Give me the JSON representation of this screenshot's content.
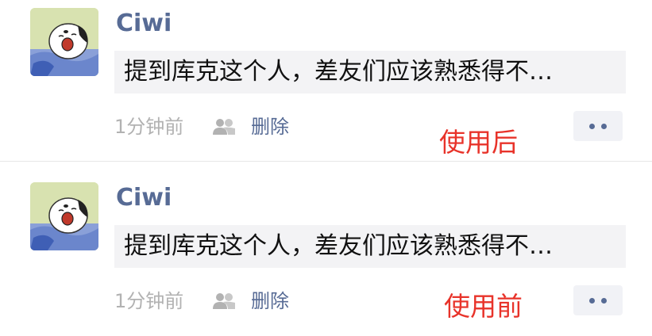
{
  "posts": [
    {
      "author": "Ciwi",
      "share_text": "提到库克这个人，差友们应该熟悉得不…",
      "time": "1分钟前",
      "friends_icon": "two-people-icon",
      "delete_label": "删除",
      "more_icon": "two-dots-icon",
      "annotation": "使用后"
    },
    {
      "author": "Ciwi",
      "share_text": "提到库克这个人，差友们应该熟悉得不…",
      "time": "1分钟前",
      "friends_icon": "two-people-icon",
      "delete_label": "删除",
      "more_icon": "two-dots-icon",
      "annotation": "使用前"
    }
  ],
  "colors": {
    "author": "#576b95",
    "link": "#576b95",
    "time": "#b2b2b2",
    "card_bg": "#f3f3f5",
    "annotation": "#e8332a"
  }
}
